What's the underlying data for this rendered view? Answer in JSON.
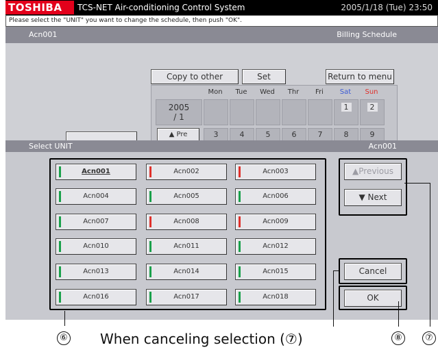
{
  "titlebar": {
    "brand": "TOSHIBA",
    "app_title": "TCS-NET Air-conditioning Control System",
    "datetime": "2005/1/18 (Tue) 23:50"
  },
  "message": "Please select the \"UNIT\" you want to change the schedule, then push \"OK\".",
  "header": {
    "left": "Acn001",
    "right": "Billing Schedule"
  },
  "toolbar": {
    "copy_label": "Copy to other section",
    "set_label": "Set",
    "return_label": "Return to menu"
  },
  "calendar": {
    "year": "2005",
    "month": "/ 1",
    "days_header": [
      "Mon",
      "Tue",
      "Wed",
      "Thr",
      "Fri",
      "Sat",
      "Sun"
    ],
    "week1": [
      "",
      "",
      "",
      "",
      "",
      "1",
      "2"
    ],
    "week2": [
      "3",
      "4",
      "5",
      "6",
      "7",
      "8",
      "9"
    ],
    "prev_label": "Pre",
    "colors": {
      "sat": "#3b5bd6",
      "sun": "#e0302a"
    }
  },
  "select_bar": {
    "left": "Select UNIT",
    "right": "Acn001"
  },
  "units": [
    {
      "label": "Acn001",
      "status": "green",
      "selected": true
    },
    {
      "label": "Acn002",
      "status": "red"
    },
    {
      "label": "Acn003",
      "status": "red"
    },
    {
      "label": "Acn004",
      "status": "green"
    },
    {
      "label": "Acn005",
      "status": "green"
    },
    {
      "label": "Acn006",
      "status": "green"
    },
    {
      "label": "Acn007",
      "status": "green"
    },
    {
      "label": "Acn008",
      "status": "red"
    },
    {
      "label": "Acn009",
      "status": "red"
    },
    {
      "label": "Acn010",
      "status": "green"
    },
    {
      "label": "Acn011",
      "status": "green"
    },
    {
      "label": "Acn012",
      "status": "green"
    },
    {
      "label": "Acn013",
      "status": "green"
    },
    {
      "label": "Acn014",
      "status": "green"
    },
    {
      "label": "Acn015",
      "status": "green"
    },
    {
      "label": "Acn016",
      "status": "green"
    },
    {
      "label": "Acn017",
      "status": "green"
    },
    {
      "label": "Acn018",
      "status": "green"
    }
  ],
  "status_colors": {
    "green": "#19a04a",
    "red": "#e0302a"
  },
  "nav": {
    "previous_label": "Previous",
    "previous_icon": "up-triangle-icon",
    "next_label": "Next",
    "next_icon": "down-triangle-icon"
  },
  "actions": {
    "cancel_label": "Cancel",
    "ok_label": "OK"
  },
  "annotations": {
    "callout_6": "⑥",
    "callout_7": "⑦",
    "callout_8": "⑧",
    "caption": "When canceling selection (⑦)"
  }
}
